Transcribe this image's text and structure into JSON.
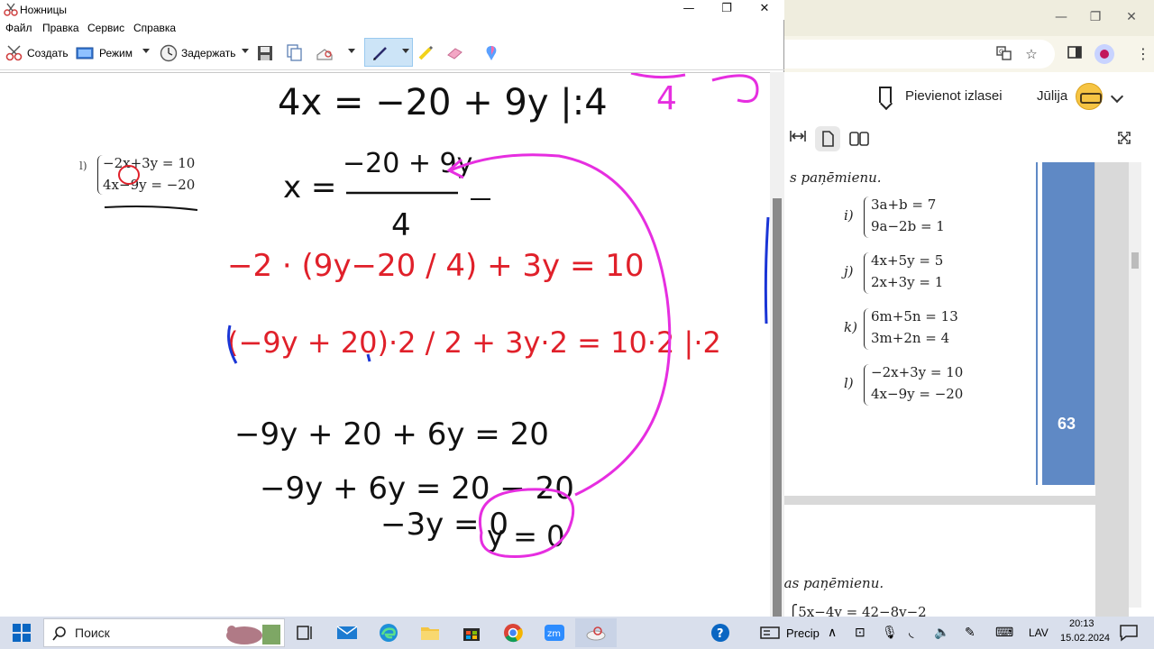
{
  "snipping_tool": {
    "title": "Ножницы",
    "window_buttons": {
      "minimize": "—",
      "maximize": "❐",
      "close": "✕"
    },
    "menu": [
      "Файл",
      "Правка",
      "Сервис",
      "Справка"
    ],
    "toolbar": {
      "create": "Создать",
      "mode": "Режим",
      "delay": "Задержать"
    },
    "problem": {
      "label": "l)",
      "eq1": "−2x+3y = 10",
      "eq2": "4x−9y = −20"
    },
    "handwriting": {
      "line1": "4x = −20 + 9y   |:4",
      "line2_lhs": "x =",
      "line2_num": "−20 + 9y",
      "line2_den": "4",
      "top_right_a": "4",
      "red1": "−2 · (9y−20 / 4) + 3y = 10",
      "red2": "(−9y + 20)·2 / 2 + 3y·2 = 10·2  |·2",
      "black1": "−9y + 20 + 6y = 20",
      "black2": "−9y + 6y = 20 − 20",
      "black3": "−3y = 0",
      "result": "y = 0"
    }
  },
  "browser": {
    "bookmark_label": "Pievienot izlasei",
    "user_name": "Jūlija",
    "book_text_top": "s paņēmienu.",
    "exercises": [
      {
        "label": "i)",
        "eq1": "3a+b = 7",
        "eq2": "9a−2b = 1"
      },
      {
        "label": "j)",
        "eq1": "4x+5y = 5",
        "eq2": "2x+3y = 1"
      },
      {
        "label": "k)",
        "eq1": "6m+5n = 13",
        "eq2": "3m+2n = 4"
      },
      {
        "label": "l)",
        "eq1": "−2x+3y = 10",
        "eq2": "4x−9y = −20"
      }
    ],
    "page_number": "63",
    "book_text_bottom": "nas paņēmienu.",
    "bottom_eq": "⎧5x−4y = 42−8y−2"
  },
  "taskbar": {
    "search_placeholder": "Поиск",
    "weather": "Precip",
    "language": "LAV",
    "time": "20:13",
    "date": "15.02.2024"
  },
  "colors": {
    "accent_red": "#e0202a",
    "accent_magenta": "#e62ee0",
    "accent_blue": "#1a35d6",
    "book_blue": "#5f89c5"
  }
}
